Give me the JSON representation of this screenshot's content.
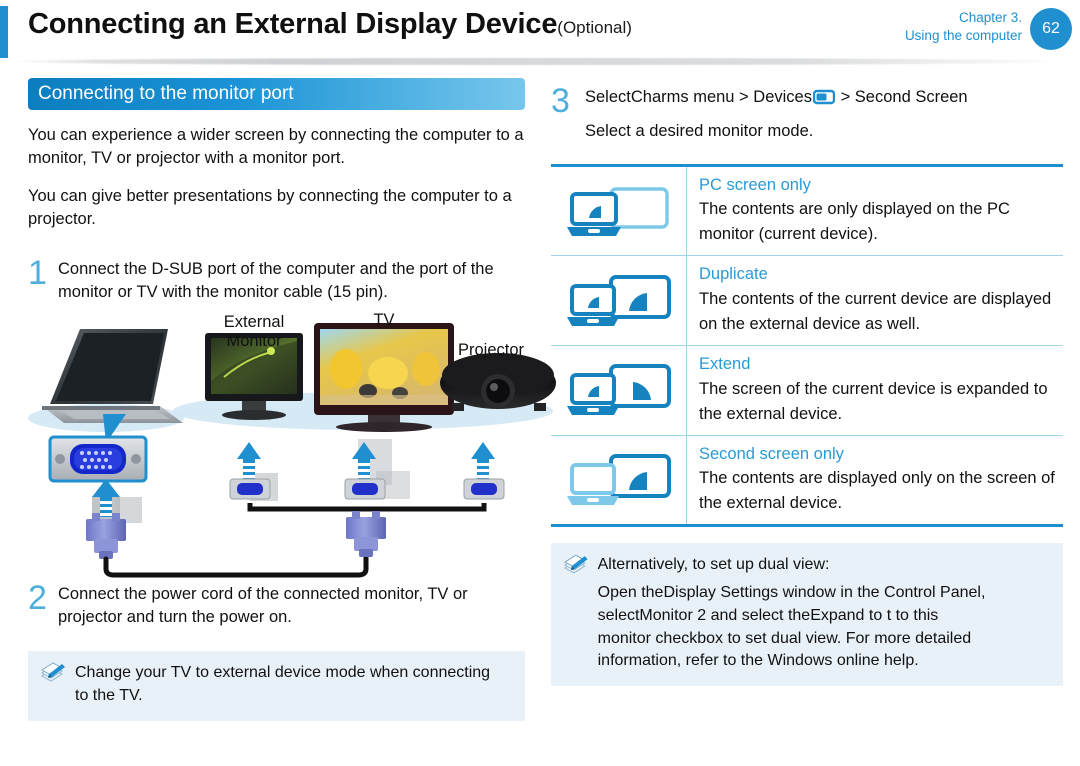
{
  "header": {
    "title": "Connecting an External Display Device",
    "title_suffix": "(Optional)",
    "chapter_line1": "Chapter 3.",
    "chapter_line2": "Using the computer",
    "page_number": "62",
    "accent_color": "#1f8fd0"
  },
  "left": {
    "section_title": "Connecting to the monitor port",
    "paragraph1": "You can experience a wider screen by connecting the computer to a monitor, TV or projector with a monitor port.",
    "paragraph2": "You can give better presentations by connecting the computer to a projector.",
    "step1": {
      "number": "1",
      "text": "Connect the D-SUB port of the computer and the port of the monitor or TV with the monitor cable (15 pin)."
    },
    "step2": {
      "number": "2",
      "text": "Connect the power cord of the connected monitor, TV or projector and turn the power on."
    },
    "note": {
      "icon": "note-pen-icon",
      "text": "Change your TV to external device mode when connecting to the TV."
    },
    "diagram": {
      "labels": {
        "external_monitor_line1": "External",
        "external_monitor_line2": "Monitor",
        "tv": "TV",
        "projector": "Projector"
      },
      "devices": [
        "laptop",
        "external-monitor",
        "tv",
        "projector"
      ],
      "connector": "vga-d-sub-15-pin"
    }
  },
  "right": {
    "step3": {
      "number": "3",
      "line1_pre": "Select",
      "line1_mid": "Charms menu > Devices",
      "line1_icon": "devices-glyph-icon",
      "line1_post": "> Second Screen",
      "line2": "Select a desired monitor mode."
    },
    "modes": [
      {
        "icon": "pc-screen-only-icon",
        "title": "PC screen only",
        "desc_line1": "The contents are only displayed on the PC",
        "desc_line2": "monitor (current device)."
      },
      {
        "icon": "duplicate-icon",
        "title": "Duplicate",
        "desc_line1": "The contents of the current device are displayed",
        "desc_line2": "on the external device as well."
      },
      {
        "icon": "extend-icon",
        "title": "Extend",
        "desc_line1": "The screen of the current device is expanded to",
        "desc_line2": "the external device."
      },
      {
        "icon": "second-screen-only-icon",
        "title": "Second screen only",
        "desc_line1": "The contents are displayed only on the screen of",
        "desc_line2": "the external device."
      }
    ],
    "note": {
      "icon": "note-pen-icon",
      "heading": "Alternatively, to set up dual view:",
      "body_line1": "Open theDisplay Settings window in the Control Panel,",
      "body_line2": "selectMonitor 2  and select theExpand to  t to this",
      "body_line3": "monitor  checkbox to set dual view. For more detailed",
      "body_line4": "information, refer to the Windows online help."
    }
  },
  "colors": {
    "accent_blue": "#1f8fd0",
    "light_blue": "#4eaede",
    "mode_title_blue": "#2a9ad6",
    "note_bg": "#e9f1f8",
    "table_rule": "#9fd3ea"
  }
}
